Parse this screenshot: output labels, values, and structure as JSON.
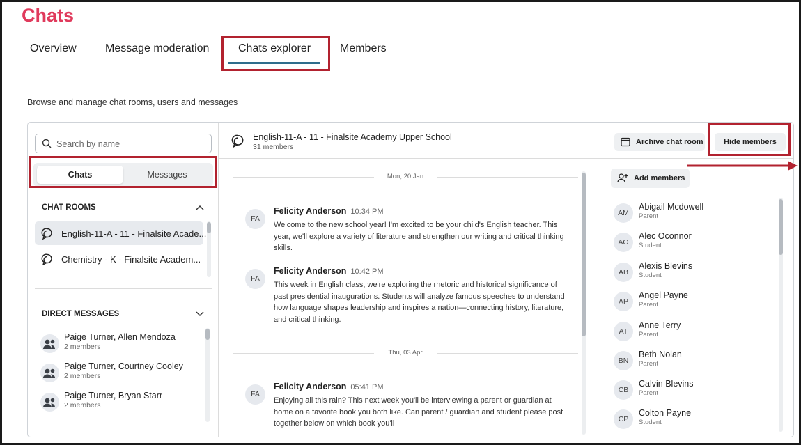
{
  "app": {
    "title": "Chats"
  },
  "tabs": [
    {
      "label": "Overview"
    },
    {
      "label": "Message moderation"
    },
    {
      "label": "Chats explorer"
    },
    {
      "label": "Members"
    }
  ],
  "subtitle": "Browse and manage chat rooms, users and messages",
  "search": {
    "placeholder": "Search by name"
  },
  "segment": {
    "chats": "Chats",
    "messages": "Messages"
  },
  "chat_rooms": {
    "heading": "CHAT ROOMS",
    "items": [
      {
        "label": "English-11-A - 11 - Finalsite Acade..."
      },
      {
        "label": "Chemistry - K - Finalsite Academ..."
      }
    ]
  },
  "direct_messages": {
    "heading": "DIRECT MESSAGES",
    "items": [
      {
        "name": "Paige Turner, Allen Mendoza",
        "count": "2 members"
      },
      {
        "name": "Paige Turner, Courtney Cooley",
        "count": "2 members"
      },
      {
        "name": "Paige Turner, Bryan Starr",
        "count": "2 members"
      }
    ]
  },
  "channel": {
    "title": "English-11-A - 11 - Finalsite Academy Upper School",
    "members": "31 members",
    "archive_label": "Archive chat room",
    "hide_members_label": "Hide members"
  },
  "messages": {
    "date1": "Mon, 20 Jan",
    "date2": "Thu, 03 Apr",
    "items": [
      {
        "initials": "FA",
        "author": "Felicity Anderson",
        "time": "10:34 PM",
        "text": "Welcome to the new school year! I'm excited to be your child's English teacher. This year, we'll explore a variety of literature and strengthen our writing and critical thinking skills."
      },
      {
        "initials": "FA",
        "author": "Felicity Anderson",
        "time": "10:42 PM",
        "text": "This week in English class, we're exploring the rhetoric and historical significance of past presidential inaugurations. Students will analyze famous speeches to understand how language shapes leadership and inspires a nation—connecting history, literature, and critical thinking."
      },
      {
        "initials": "FA",
        "author": "Felicity Anderson",
        "time": "05:41 PM",
        "text": "Enjoying all this rain? This next week you'll be interviewing a parent or guardian at home on a favorite book you both like. Can parent / guardian and student please post together below on which book you'll"
      }
    ]
  },
  "members_panel": {
    "add_label": "Add members",
    "items": [
      {
        "initials": "AM",
        "name": "Abigail Mcdowell",
        "role": "Parent"
      },
      {
        "initials": "AO",
        "name": "Alec Oconnor",
        "role": "Student"
      },
      {
        "initials": "AB",
        "name": "Alexis Blevins",
        "role": "Student"
      },
      {
        "initials": "AP",
        "name": "Angel Payne",
        "role": "Parent"
      },
      {
        "initials": "AT",
        "name": "Anne Terry",
        "role": "Parent"
      },
      {
        "initials": "BN",
        "name": "Beth Nolan",
        "role": "Parent"
      },
      {
        "initials": "CB",
        "name": "Calvin Blevins",
        "role": "Parent"
      },
      {
        "initials": "CP",
        "name": "Colton Payne",
        "role": "Student"
      }
    ]
  },
  "colors": {
    "brand": "#e03a5c",
    "highlight": "#b2222f",
    "tab_underline": "#2f6d8c"
  }
}
